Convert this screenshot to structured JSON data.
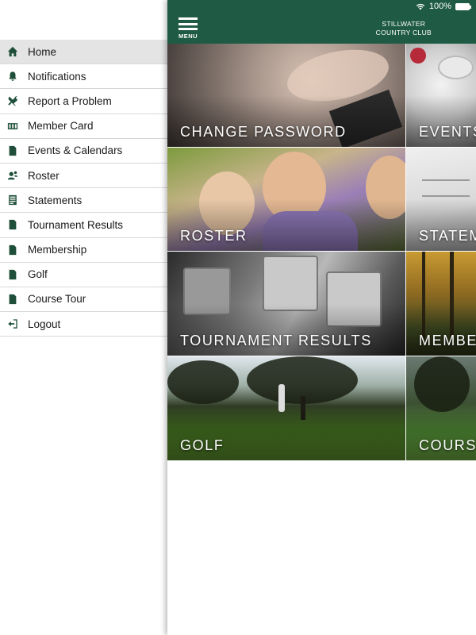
{
  "status_bar": {
    "battery_text": "100%",
    "icons": [
      "wifi-icon",
      "battery-icon"
    ]
  },
  "sidebar": {
    "items": [
      {
        "label": "Home",
        "icon": "home-icon",
        "active": true
      },
      {
        "label": "Notifications",
        "icon": "bell-icon"
      },
      {
        "label": "Report a Problem",
        "icon": "tools-icon"
      },
      {
        "label": "Member Card",
        "icon": "card-icon"
      },
      {
        "label": "Events & Calendars",
        "icon": "document-icon"
      },
      {
        "label": "Roster",
        "icon": "people-icon"
      },
      {
        "label": "Statements",
        "icon": "statement-icon"
      },
      {
        "label": "Tournament Results",
        "icon": "document-icon"
      },
      {
        "label": "Membership",
        "icon": "document-icon"
      },
      {
        "label": "Golf",
        "icon": "document-icon"
      },
      {
        "label": "Course Tour",
        "icon": "document-icon"
      },
      {
        "label": "Logout",
        "icon": "logout-icon"
      }
    ]
  },
  "header": {
    "menu_label": "MENU",
    "club_line1": "STILLWATER",
    "club_line2": "COUNTRY CLUB",
    "background_color": "#1f5a45"
  },
  "tiles": [
    {
      "label": "CHANGE PASSWORD"
    },
    {
      "label": "EVENTS"
    },
    {
      "label": "ROSTER"
    },
    {
      "label": "STATEM"
    },
    {
      "label": "TOURNAMENT RESULTS"
    },
    {
      "label": "MEMBE"
    },
    {
      "label": "GOLF"
    },
    {
      "label": "COURSE"
    }
  ],
  "colors": {
    "accent": "#1f5a45",
    "icon": "#1f4f3a",
    "active_row": "#e4e4e4"
  }
}
